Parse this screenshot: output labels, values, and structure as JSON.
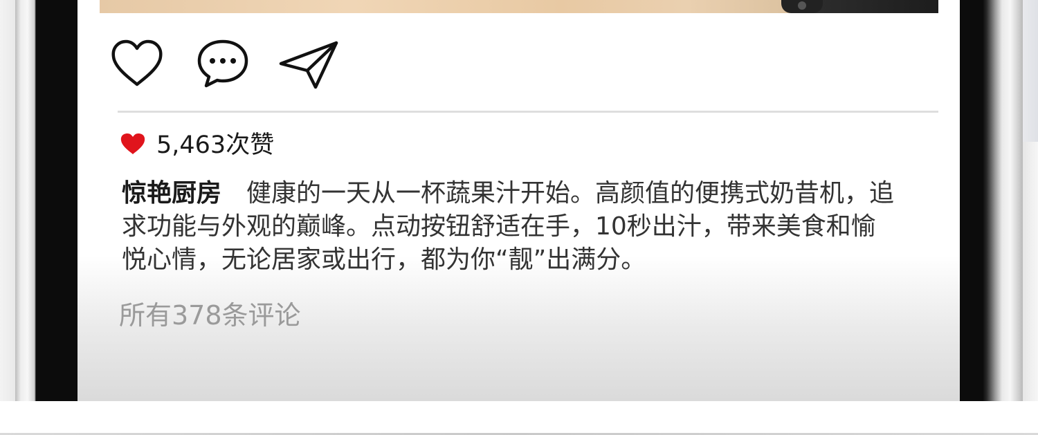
{
  "post": {
    "actions": {
      "like_icon": "heart-outline-icon",
      "comment_icon": "speech-bubble-icon",
      "share_icon": "paper-plane-icon"
    },
    "likes": {
      "icon": "heart-filled-icon",
      "icon_color": "#e0141c",
      "text": "5,463次赞"
    },
    "caption": {
      "author": "惊艳厨房",
      "text": "健康的一天从一杯蔬果汁开始。高颜值的便携式奶昔机，追求功能与外观的巅峰。点动按钮舒适在手，10秒出汁，带来美食和愉悦心情，无论居家或出行，都为你“靓”出满分。"
    },
    "comments_link": "所有378条评论"
  }
}
